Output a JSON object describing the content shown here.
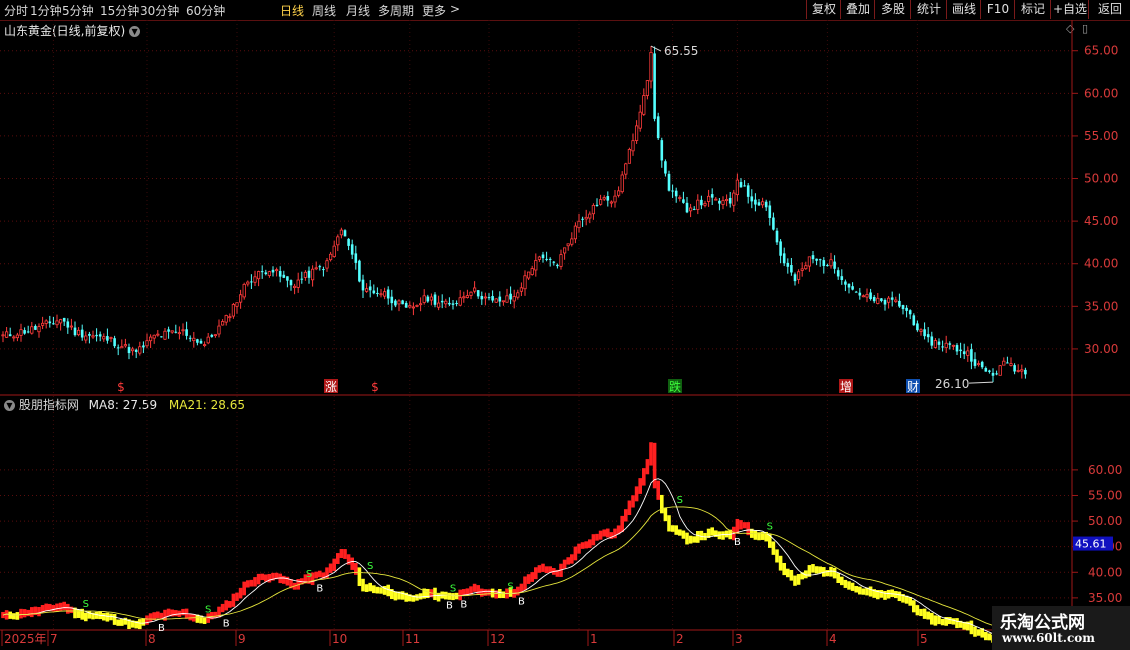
{
  "toolbar": {
    "periods": [
      "分时",
      "1分钟",
      "5分钟",
      "15分钟",
      "30分钟",
      "60分钟",
      "日线",
      "周线",
      "月线",
      "多周期",
      "更多"
    ],
    "active_period": "日线",
    "more_arrow": ">",
    "buttons": [
      "复权",
      "叠加",
      "多股",
      "统计",
      "画线",
      "F10",
      "标记",
      "+自选",
      "返回"
    ]
  },
  "main_chart": {
    "title": "山东黄金(日线,前复权)",
    "y_ticks": [
      "65.00",
      "60.00",
      "55.00",
      "50.00",
      "45.00",
      "40.00",
      "35.00",
      "30.00"
    ],
    "max_label": "65.55",
    "min_label": "26.10",
    "event_markers": [
      {
        "text": "$",
        "color": "#ff3b3b"
      },
      {
        "text": "涨",
        "color": "#ffffff",
        "bg": "#b01818"
      },
      {
        "text": "$",
        "color": "#ff3b3b"
      },
      {
        "text": "跌",
        "color": "#3cff3c",
        "bg": "#106010"
      },
      {
        "text": "增",
        "color": "#ffffff",
        "bg": "#b01818"
      },
      {
        "text": "财",
        "color": "#ffffff",
        "bg": "#1050b0"
      }
    ]
  },
  "indicator": {
    "name": "股朋指标网",
    "ma8": "MA8: 27.59",
    "ma21": "MA21: 28.65",
    "y_ticks": [
      "60.00",
      "55.00",
      "50.00",
      "45.00",
      "40.00",
      "35.00"
    ],
    "current_value": "45.61"
  },
  "x_axis": {
    "labels": [
      "2025年",
      "7",
      "8",
      "9",
      "10",
      "11",
      "12",
      "1",
      "2",
      "3",
      "4",
      "5"
    ]
  },
  "watermark": {
    "line1": "乐淘公式网",
    "line2": "www.60lt.com"
  },
  "chart_data": {
    "type": "candlestick",
    "title": "山东黄金(日线,前复权)",
    "ylim": [
      26,
      66
    ],
    "months": [
      "7",
      "8",
      "9",
      "10",
      "11",
      "12",
      "1",
      "2",
      "3",
      "4",
      "5"
    ],
    "anchors": [
      [
        0,
        31.5
      ],
      [
        10,
        32.5
      ],
      [
        16,
        33.5
      ],
      [
        20,
        32.0
      ],
      [
        30,
        31.0
      ],
      [
        37,
        29.5
      ],
      [
        42,
        31.5
      ],
      [
        50,
        32.0
      ],
      [
        56,
        30.5
      ],
      [
        62,
        33.5
      ],
      [
        68,
        38.0
      ],
      [
        74,
        39.5
      ],
      [
        80,
        37.5
      ],
      [
        86,
        39.0
      ],
      [
        90,
        40.0
      ],
      [
        94,
        44.0
      ],
      [
        97,
        41.0
      ],
      [
        100,
        37.0
      ],
      [
        106,
        36.5
      ],
      [
        112,
        34.5
      ],
      [
        118,
        36.0
      ],
      [
        124,
        35.0
      ],
      [
        130,
        37.0
      ],
      [
        136,
        35.5
      ],
      [
        142,
        36.0
      ],
      [
        148,
        40.5
      ],
      [
        154,
        40.0
      ],
      [
        160,
        45.0
      ],
      [
        166,
        47.5
      ],
      [
        170,
        47.5
      ],
      [
        174,
        53.0
      ],
      [
        178,
        60.0
      ],
      [
        180,
        64.0
      ],
      [
        182,
        54.5
      ],
      [
        185,
        48.5
      ],
      [
        190,
        46.5
      ],
      [
        196,
        47.5
      ],
      [
        202,
        47.0
      ],
      [
        204,
        50.0
      ],
      [
        208,
        47.5
      ],
      [
        212,
        47.0
      ],
      [
        216,
        41.0
      ],
      [
        220,
        38.0
      ],
      [
        224,
        40.5
      ],
      [
        230,
        40.0
      ],
      [
        236,
        37.0
      ],
      [
        242,
        35.5
      ],
      [
        248,
        35.5
      ],
      [
        252,
        34.0
      ],
      [
        256,
        31.0
      ],
      [
        262,
        30.5
      ],
      [
        268,
        29.5
      ],
      [
        272,
        27.5
      ],
      [
        275,
        27.0
      ],
      [
        279,
        28.5
      ],
      [
        282,
        27.5
      ]
    ],
    "series": [
      {
        "name": "MA8",
        "values": []
      },
      {
        "name": "MA21",
        "values": []
      }
    ]
  }
}
